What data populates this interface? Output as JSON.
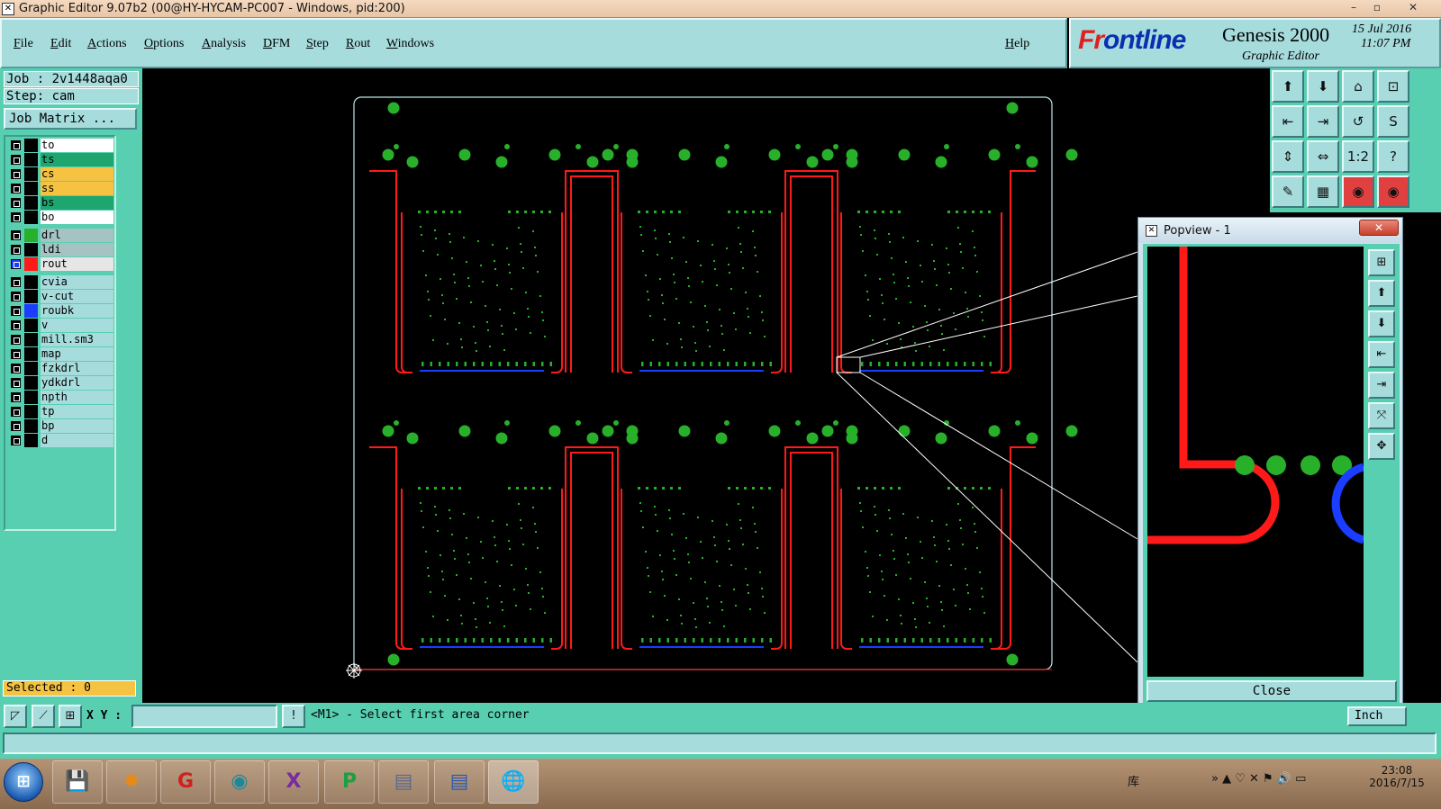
{
  "window": {
    "title": "Graphic Editor 9.07b2 (00@HY-HYCAM-PC007 - Windows, pid:200)",
    "minimize": "–",
    "maximize": "▫",
    "close": "✕"
  },
  "menu": {
    "items": [
      "File",
      "Edit",
      "Actions",
      "Options",
      "Analysis",
      "DFM",
      "Step",
      "Rout",
      "Windows"
    ],
    "help": "Help"
  },
  "brand": {
    "logo_prefix": "Fr",
    "logo_rest": "ontline",
    "product": "Genesis 2000",
    "subtitle": "Graphic Editor",
    "date": "15 Jul 2016",
    "time": "11:07 PM"
  },
  "job": {
    "job_line": "Job : 2v1448aqa0",
    "step_line": "Step: cam",
    "matrix_button": "Job Matrix ..."
  },
  "layers": [
    {
      "name": "to",
      "color": "#ffffff",
      "swatch": ""
    },
    {
      "name": "ts",
      "color": "#1fa56e",
      "swatch": ""
    },
    {
      "name": "cs",
      "color": "#f5c242",
      "swatch": ""
    },
    {
      "name": "ss",
      "color": "#f5c242",
      "swatch": ""
    },
    {
      "name": "bs",
      "color": "#1fa56e",
      "swatch": ""
    },
    {
      "name": "bo",
      "color": "#ffffff",
      "swatch": ""
    },
    {
      "name": "drl",
      "color": "#a6c3c4",
      "swatch": "#29b02a"
    },
    {
      "name": "ldi",
      "color": "#a6c3c4",
      "swatch": ""
    },
    {
      "name": "rout",
      "color": "#e6e6e6",
      "swatch": "#ff1a1a",
      "active": true
    },
    {
      "name": "cvia",
      "color": "#a7dcdd",
      "swatch": ""
    },
    {
      "name": "v-cut",
      "color": "#a7dcdd",
      "swatch": ""
    },
    {
      "name": "roubk",
      "color": "#a7dcdd",
      "swatch": "#1a3dff"
    },
    {
      "name": "v",
      "color": "#a7dcdd",
      "swatch": ""
    },
    {
      "name": "mill.sm3",
      "color": "#a7dcdd",
      "swatch": ""
    },
    {
      "name": "map",
      "color": "#a7dcdd",
      "swatch": ""
    },
    {
      "name": "fzkdrl",
      "color": "#a7dcdd",
      "swatch": ""
    },
    {
      "name": "ydkdrl",
      "color": "#a7dcdd",
      "swatch": ""
    },
    {
      "name": "npth",
      "color": "#a7dcdd",
      "swatch": ""
    },
    {
      "name": "tp",
      "color": "#a7dcdd",
      "swatch": ""
    },
    {
      "name": "bp",
      "color": "#a7dcdd",
      "swatch": ""
    },
    {
      "name": "d",
      "color": "#a7dcdd",
      "swatch": ""
    }
  ],
  "selected": "Selected : 0",
  "tools": {
    "icons": [
      "⬆",
      "⬇",
      "⌂",
      "⊡",
      "⇤",
      "⇥",
      "↺",
      "S",
      "⇕",
      "⇔",
      "1:2",
      "?",
      "✎",
      "▦",
      "◉",
      "◉"
    ]
  },
  "popview": {
    "title": "Popview - 1",
    "close_x": "✕",
    "close_button": "Close",
    "tools": [
      "⊞",
      "⬆",
      "⬇",
      "⇤",
      "⇥",
      "⤧",
      "✥"
    ]
  },
  "command": {
    "xy_label": "X Y :",
    "xy_value": "",
    "excl": "!",
    "message": "<M1> - Select first area corner",
    "units": "Inch"
  },
  "taskbar": {
    "start": "⊞",
    "apps": [
      "💾",
      "✹",
      "G",
      "◉",
      "X",
      "P",
      "▤",
      "▤",
      "🌐"
    ],
    "tray_label": "库",
    "tray_icons": "» ▲ ♡ ✕ ⚑ 🔊 ▭",
    "clock_time": "23:08",
    "clock_date": "2016/7/15"
  },
  "colors": {
    "panel": "#a7dcdd",
    "panel_green": "#59cfb2",
    "rout": "#ff1a1a",
    "drill": "#29b02a",
    "roubk": "#1a3dff",
    "profile": "#bfe9ea"
  }
}
